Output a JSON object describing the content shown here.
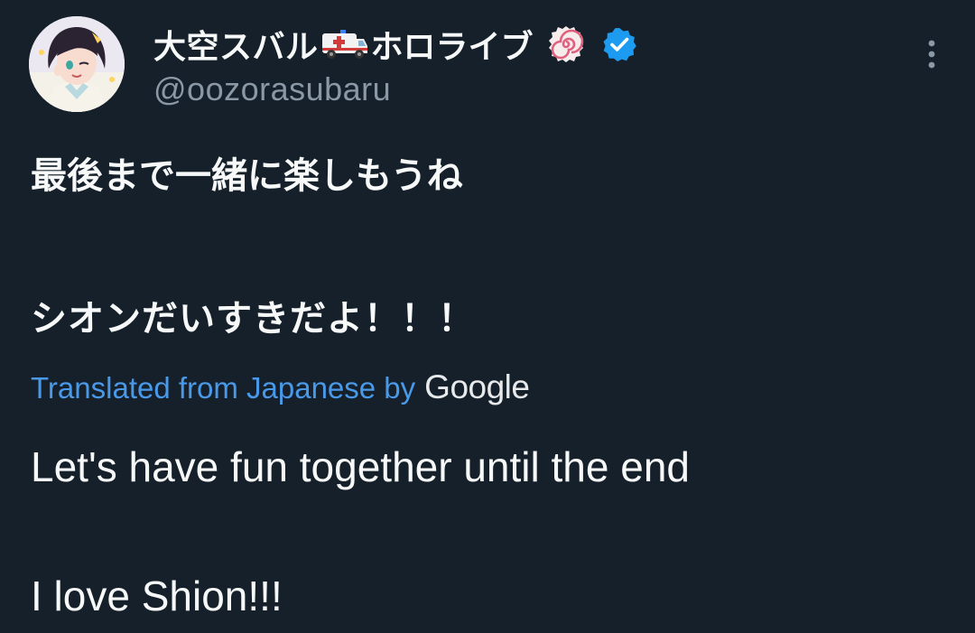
{
  "author": {
    "display_name_part1": "大空スバル",
    "display_name_part2": "ホロライブ",
    "emoji_1": "ambulance-icon",
    "emoji_2": "fish-cake-swirl-icon",
    "badge": "verified-badge-icon",
    "handle": "@oozorasubaru"
  },
  "menu": {
    "icon": "more-vertical-icon"
  },
  "tweet": {
    "original_line_1": "最後まで一緒に楽しもうね",
    "original_line_2": "シオンだいすきだよ！！！",
    "translation_label": "Translated from Japanese by",
    "translation_provider": "Google",
    "translated_line_1": "Let's have fun together until the end",
    "translated_line_2": "I love Shion!!!"
  },
  "colors": {
    "background": "#15202b",
    "text": "#f7f9f9",
    "secondary_text": "#8b98a5",
    "link": "#4a99e9",
    "verified": "#1d9bf0"
  }
}
